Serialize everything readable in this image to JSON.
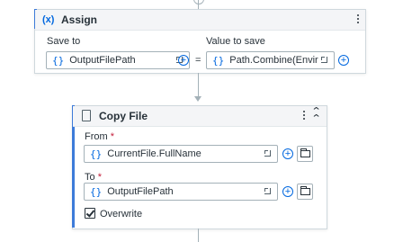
{
  "assign": {
    "title": "Assign",
    "icon_text": "(x)",
    "save_to_label": "Save to",
    "value_to_save_label": "Value to save",
    "save_to_value": "OutputFilePath",
    "value_to_save_value": "Path.Combine(Environ",
    "equals": "="
  },
  "copy_file": {
    "title": "Copy File",
    "from_label": "From",
    "from_value": "CurrentFile.FullName",
    "to_label": "To",
    "to_value": "OutputFilePath",
    "required_mark": "*",
    "overwrite_label": "Overwrite",
    "overwrite_checked": true
  },
  "icons": {
    "brace": "{}",
    "plus": "+",
    "collapse": "chevron-double-up-icon",
    "menu": "more-vertical-icon"
  },
  "colors": {
    "accent": "#3d7bd9",
    "brace_blue": "#0067df",
    "border": "#a4b1b8",
    "required": "#c41e3a"
  }
}
